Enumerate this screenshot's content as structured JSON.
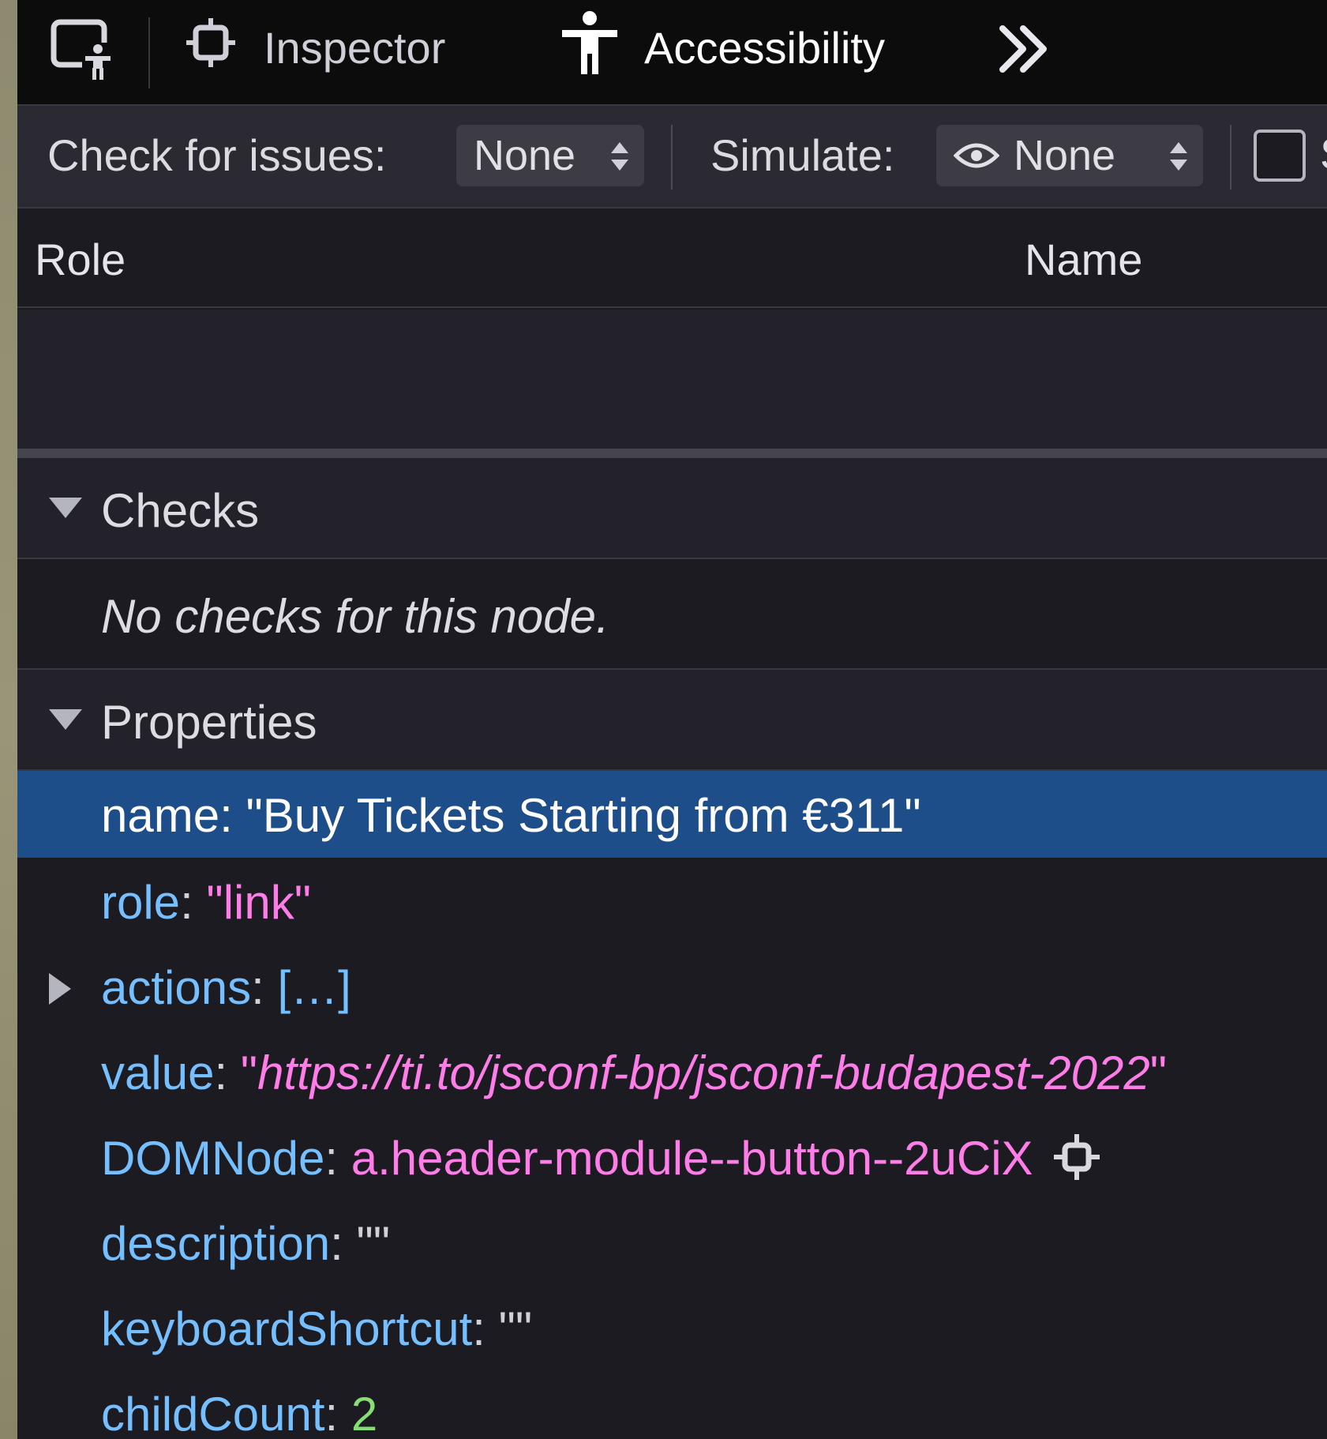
{
  "tabs": {
    "inspector_label": "Inspector",
    "accessibility_label": "Accessibility",
    "more_icon": "double-chevron-right-icon"
  },
  "toolbar": {
    "check_label": "Check for issues:",
    "check_value": "None",
    "simulate_label": "Simulate:",
    "simulate_value": "None",
    "checkbox_peek": "S"
  },
  "tree": {
    "col_role": "Role",
    "col_name": "Name"
  },
  "checks": {
    "title": "Checks",
    "empty_text": "No checks for this node."
  },
  "properties": {
    "title": "Properties",
    "name": {
      "key": "name",
      "value": "\"Buy Tickets Starting from €311\""
    },
    "role": {
      "key": "role",
      "value": "\"link\""
    },
    "actions": {
      "key": "actions",
      "value": "[…]"
    },
    "value": {
      "key": "value",
      "open_q": "\"",
      "value": "https://ti.to/jsconf-bp/jsconf-budapest-2022",
      "close_q": "\""
    },
    "domnode": {
      "key": "DOMNode",
      "value": "a.header-module--button--2uCiX"
    },
    "description": {
      "key": "description",
      "value": "\"\""
    },
    "keyboard": {
      "key": "keyboardShortcut",
      "value": "\"\""
    },
    "childcount": {
      "key": "childCount",
      "value": "2"
    }
  },
  "colors": {
    "panel_bg": "#1c1b22",
    "selected_row": "#1e4e89",
    "key": "#75bfff",
    "string": "#ff7de9",
    "number": "#86de74"
  }
}
